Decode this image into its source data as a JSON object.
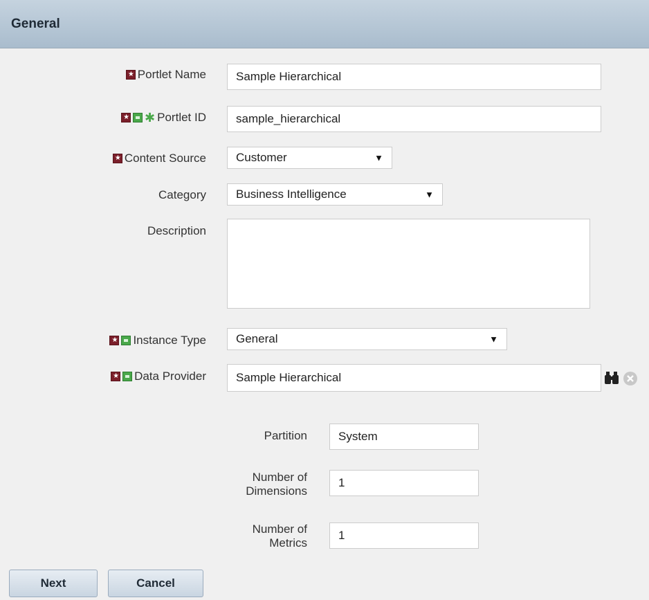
{
  "header": {
    "title": "General"
  },
  "form": {
    "portlet_name": {
      "label": "Portlet Name",
      "value": "Sample Hierarchical"
    },
    "portlet_id": {
      "label": "Portlet ID",
      "value": "sample_hierarchical"
    },
    "content_source": {
      "label": "Content Source",
      "value": "Customer"
    },
    "category": {
      "label": "Category",
      "value": "Business Intelligence"
    },
    "description": {
      "label": "Description",
      "value": ""
    },
    "instance_type": {
      "label": "Instance Type",
      "value": "General"
    },
    "data_provider": {
      "label": "Data Provider",
      "value": "Sample Hierarchical"
    },
    "partition": {
      "label": "Partition",
      "value": "System"
    },
    "num_dimensions": {
      "label_line1": "Number of",
      "label_line2": "Dimensions",
      "value": "1"
    },
    "num_metrics": {
      "label_line1": "Number of",
      "label_line2": "Metrics",
      "value": "1"
    }
  },
  "buttons": {
    "next": "Next",
    "cancel": "Cancel"
  },
  "icons": {
    "required": "required-star-icon",
    "optional": "green-square-icon",
    "asterisk": "asterisk-icon",
    "search": "binoculars-icon",
    "clear": "clear-circle-icon"
  },
  "colors": {
    "header": "#b5c5d4",
    "required": "#7b1f2a",
    "optional": "#4aa84a"
  }
}
